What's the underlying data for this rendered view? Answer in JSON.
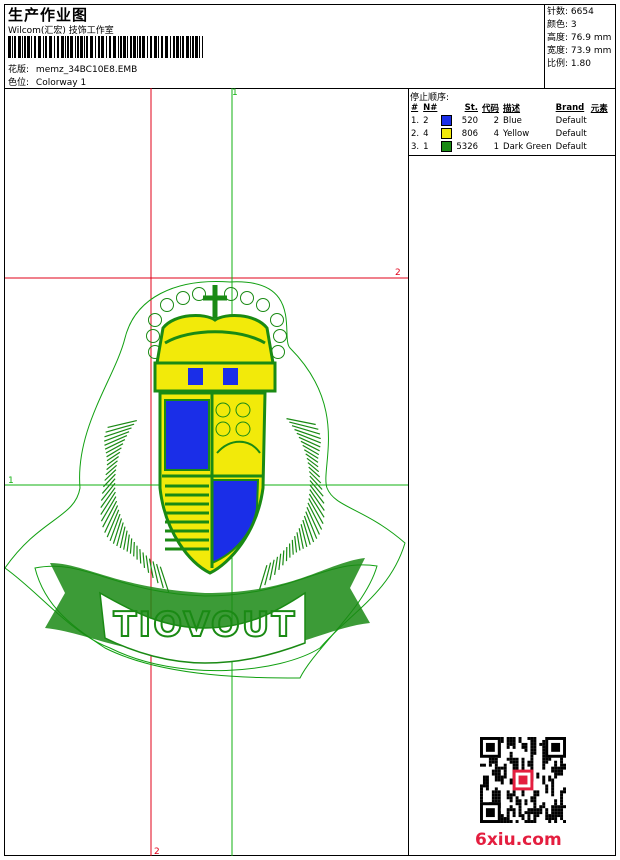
{
  "header": {
    "title": "生产作业图",
    "studio": "Wilcom(汇宏) 技饰工作室",
    "design_label": "花版:",
    "design_value": "memz_34BC10E8.EMB",
    "colorway_label": "色位:",
    "colorway_value": "Colorway 1"
  },
  "specs": [
    {
      "label": "针数:",
      "value": "6654"
    },
    {
      "label": "颜色:",
      "value": "3"
    },
    {
      "label": "高度:",
      "value": "76.9 mm"
    },
    {
      "label": "宽度:",
      "value": "73.9 mm"
    },
    {
      "label": "比例:",
      "value": "1.80"
    }
  ],
  "stop_sequence": {
    "title": "停止顺序:",
    "headers": [
      "#",
      "N#",
      "St.",
      "代码",
      "描述",
      "Brand",
      "元素"
    ],
    "rows": [
      {
        "idx": "1.",
        "n": "2",
        "color": "#1a2ee8",
        "st": "520",
        "code": "2",
        "desc": "Blue",
        "brand": "Default"
      },
      {
        "idx": "2.",
        "n": "4",
        "color": "#f2ea0a",
        "st": "806",
        "code": "4",
        "desc": "Yellow",
        "brand": "Default"
      },
      {
        "idx": "3.",
        "n": "1",
        "color": "#1a8a14",
        "st": "5326",
        "code": "1",
        "desc": "Dark Green",
        "brand": "Default"
      }
    ]
  },
  "guides": {
    "v1_label": "1",
    "h1_label": "1",
    "h2_label": "2",
    "v2_label": "2"
  },
  "design": {
    "banner_text": "TIOVOUT",
    "colors": {
      "green": "#1a8a14",
      "blue": "#1a2ee8",
      "yellow": "#f2ea0a",
      "red": "#e0001a",
      "outline": "#11a011"
    }
  },
  "watermark": "6xiu.com"
}
